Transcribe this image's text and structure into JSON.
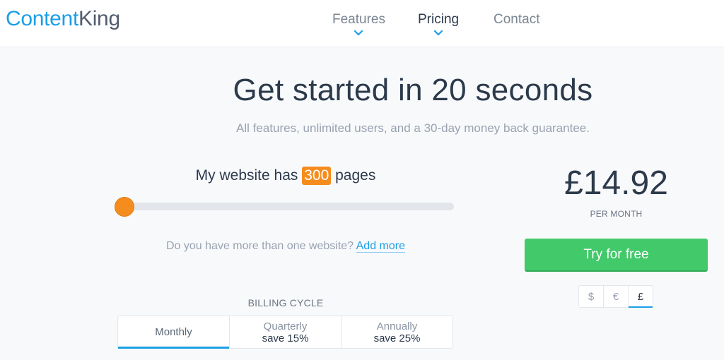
{
  "header": {
    "logo_part1": "Content",
    "logo_part2": "King",
    "nav": [
      {
        "label": "Features",
        "has_dropdown": true,
        "icon": "chevron-down-icon"
      },
      {
        "label": "Pricing",
        "has_dropdown": true,
        "icon": "chevron-down-icon",
        "active": true
      },
      {
        "label": "Contact",
        "has_dropdown": false
      }
    ]
  },
  "hero": {
    "title": "Get started in 20 seconds",
    "subtitle": "All features, unlimited users, and a 30-day money back guarantee."
  },
  "pages": {
    "prefix": "My website has",
    "count": "300",
    "suffix": "pages",
    "slider_fraction": 0.0
  },
  "more_sites": {
    "question": "Do you have more than one website?",
    "link": "Add more"
  },
  "billing": {
    "title": "BILLING CYCLE",
    "options": [
      {
        "name": "Monthly",
        "save": "",
        "active": true
      },
      {
        "name": "Quarterly",
        "save": "save 15%"
      },
      {
        "name": "Annually",
        "save": "save 25%"
      }
    ]
  },
  "pricing": {
    "price": "£14.92",
    "period": "PER MONTH",
    "cta": "Try for free",
    "currencies": [
      {
        "symbol": "$"
      },
      {
        "symbol": "€"
      },
      {
        "symbol": "£",
        "active": true
      }
    ]
  },
  "colors": {
    "brand_blue": "#1b9ee6",
    "accent_orange": "#f58c1e",
    "cta_green": "#41c96a"
  }
}
